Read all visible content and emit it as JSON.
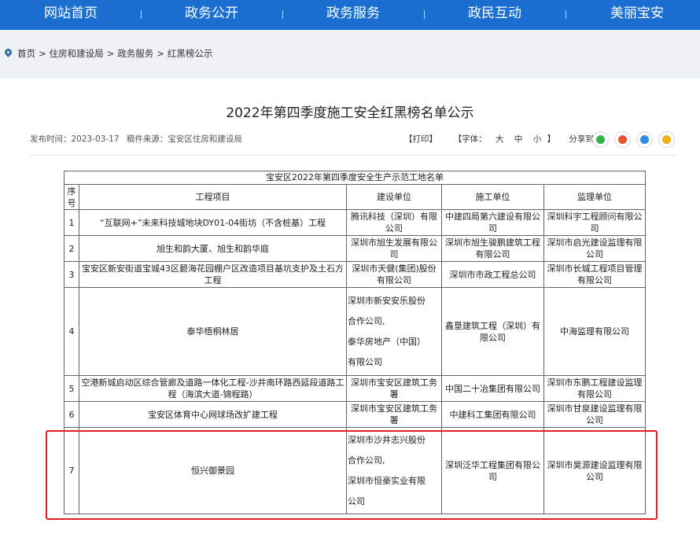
{
  "nav": {
    "items": [
      "网站首页",
      "政务公开",
      "政务服务",
      "政民互动",
      "美丽宝安"
    ]
  },
  "breadcrumb": {
    "items": [
      "首页",
      "住房和建设局",
      "政务服务",
      "红黑榜公示"
    ],
    "separator": ">"
  },
  "article": {
    "title": "2022年第四季度施工安全红黑榜名单公示",
    "publish_label": "发布时间：",
    "publish_date": "2023-03-17",
    "source_label": "稿件来源：",
    "source": "宝安区住房和建设局",
    "print_label": "【打印】",
    "font_label": "【字体：",
    "font_large": "大",
    "font_medium": "中",
    "font_small": "小",
    "font_close": "】",
    "share_label": "分享到：",
    "share_icons": [
      "wechat-icon",
      "weibo-icon",
      "qq-icon",
      "qzone-icon"
    ],
    "share_colors": [
      "#35b04a",
      "#e8532f",
      "#2d8de0",
      "#f0b21c"
    ]
  },
  "table": {
    "caption": "宝安区2022年第四季度安全生产示范工地名单",
    "headers": [
      "序号",
      "工程项目",
      "建设单位",
      "施工单位",
      "监理单位"
    ],
    "rows": [
      {
        "no": "1",
        "project": "“互联网+”未来科技城地块DY01-04街坊（不含桩基）工程",
        "builder": "腾讯科技（深圳）有限公司",
        "contractor": "中建四局第六建设有限公司",
        "supervisor": "深圳科宇工程顾问有限公司"
      },
      {
        "no": "2",
        "project": "旭生和韵大厦、旭生和韵华庭",
        "builder": "深圳市旭生发展有限公司",
        "contractor": "深圳市旭生骏鹏建筑工程有限公司",
        "supervisor": "深圳市启光建设监理有限公司"
      },
      {
        "no": "3",
        "project": "宝安区新安街道宝城43区碧海花园棚户区改造项目基坑支护及土石方工程",
        "builder": "深圳市天健(集团)股份有限公司",
        "contractor": "深圳市市政工程总公司",
        "supervisor": "深圳市长城工程项目管理有限公司"
      },
      {
        "no": "4",
        "project": "泰华梧桐林居",
        "builder_lines": [
          "深圳市新安安乐股份",
          "合作公司,",
          "泰华房地产（中国）",
          "有限公司"
        ],
        "contractor": "鑫垦建筑工程（深圳）有限公司",
        "supervisor": "中海监理有限公司"
      },
      {
        "no": "5",
        "project": "空港新城启动区综合管廊及道路一体化工程-沙井南环路西延段道路工程（海滨大道-锦程路）",
        "builder": "深圳市宝安区建筑工务署",
        "contractor": "中国二十冶集团有限公司",
        "supervisor": "深圳市东鹏工程建设监理有限公司"
      },
      {
        "no": "6",
        "project": "宝安区体育中心网球场改扩建工程",
        "builder": "深圳市宝安区建筑工务署",
        "contractor": "中建科工集团有限公司",
        "supervisor": "深圳市甘泉建设监理有限公司"
      },
      {
        "no": "7",
        "project": "恒兴御景园",
        "builder_lines": [
          "深圳市沙井志兴股份",
          "合作公司,",
          "深圳市恒豪实业有限",
          "公司"
        ],
        "contractor": "深圳泛华工程集团有限公司",
        "supervisor": "深圳市昊源建设监理有限公司"
      }
    ]
  },
  "highlight": {
    "color": "#e02020",
    "row_index": 7
  },
  "colors": {
    "nav_bg": "#1a6fd0",
    "page_bg": "#eef1f5"
  }
}
